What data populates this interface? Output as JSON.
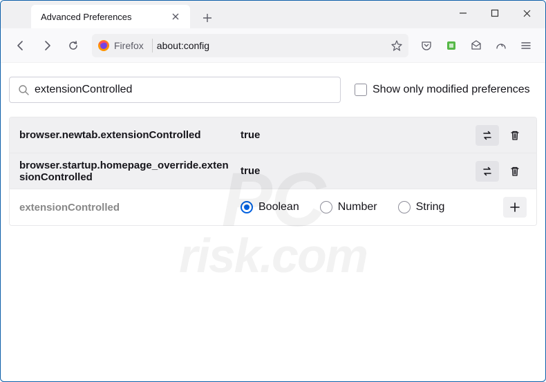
{
  "window": {
    "tab_title": "Advanced Preferences"
  },
  "urlbar": {
    "brand": "Firefox",
    "url": "about:config"
  },
  "search": {
    "value": "extensionControlled",
    "checkbox_label": "Show only modified preferences"
  },
  "prefs": [
    {
      "name": "browser.newtab.extensionControlled",
      "value": "true"
    },
    {
      "name": "browser.startup.homepage_override.extensionControlled",
      "value": "true"
    }
  ],
  "new_pref": {
    "name": "extensionControlled",
    "types": [
      "Boolean",
      "Number",
      "String"
    ],
    "selected": "Boolean"
  },
  "watermark": {
    "line1": "PC",
    "line2": "risk.com"
  }
}
